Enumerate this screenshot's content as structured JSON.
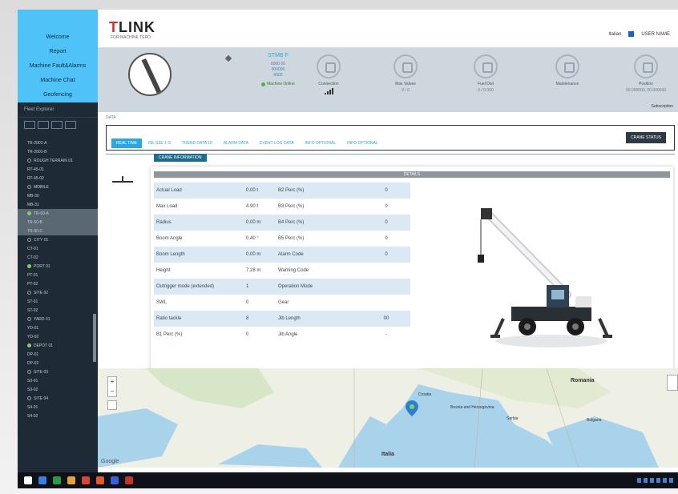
{
  "sidebar": {
    "links": [
      "Welcome",
      "Report",
      "Machine Fault&Alarms",
      "Machine Chat",
      "Geofencing"
    ],
    "tree_header": "Fleet Explorer",
    "items": [
      {
        "label": "TR-2001-A",
        "state": "none"
      },
      {
        "label": "TR-2001-B",
        "state": "none"
      },
      {
        "label": "ROUGH TERRAIN 01",
        "state": "off"
      },
      {
        "label": "RT-45-01",
        "state": "none"
      },
      {
        "label": "RT-45-02",
        "state": "none"
      },
      {
        "label": "MOBILE",
        "state": "off"
      },
      {
        "label": "MB-30",
        "state": "none"
      },
      {
        "label": "MB-31",
        "state": "none"
      },
      {
        "label": "TR-60-A",
        "state": "on",
        "selected": true
      },
      {
        "label": "TR-60-B",
        "state": "none",
        "selected": true
      },
      {
        "label": "TR-60-C",
        "state": "none",
        "selected": true
      },
      {
        "label": "CITY 01",
        "state": "off"
      },
      {
        "label": "CT-01",
        "state": "none"
      },
      {
        "label": "CT-02",
        "state": "none"
      },
      {
        "label": "PORT 01",
        "state": "on"
      },
      {
        "label": "PT-01",
        "state": "none"
      },
      {
        "label": "PT-02",
        "state": "none"
      },
      {
        "label": "SITE 02",
        "state": "off"
      },
      {
        "label": "ST-01",
        "state": "none"
      },
      {
        "label": "ST-02",
        "state": "none"
      },
      {
        "label": "YARD 01",
        "state": "off"
      },
      {
        "label": "YD-01",
        "state": "none"
      },
      {
        "label": "YD-02",
        "state": "none"
      },
      {
        "label": "DEPOT 01",
        "state": "on"
      },
      {
        "label": "DP-01",
        "state": "none"
      },
      {
        "label": "DP-02",
        "state": "none"
      },
      {
        "label": "SITE 03",
        "state": "off"
      },
      {
        "label": "S3-01",
        "state": "none"
      },
      {
        "label": "S3-02",
        "state": "none"
      },
      {
        "label": "SITE 04",
        "state": "off"
      },
      {
        "label": "S4-01",
        "state": "none"
      },
      {
        "label": "S4-02",
        "state": "none"
      }
    ]
  },
  "header": {
    "logo_accent": "T",
    "logo_rest": "LINK",
    "logo_sub": "FOR MACHINE TERO",
    "lang": "Italian",
    "user": "USER NAME"
  },
  "status": {
    "model": "STMB F",
    "model_lines": [
      "0000 00",
      "000000",
      "0000"
    ],
    "online": "Machine Online",
    "kpis": [
      {
        "label": "Connection",
        "value": ""
      },
      {
        "label": "Max Values",
        "value": "0 / 0"
      },
      {
        "label": "Fuel Dist",
        "value": "0 / 0 000"
      },
      {
        "label": "Maintenance",
        "value": ""
      },
      {
        "label": "Position",
        "value": "00.000000, 00.000000"
      }
    ],
    "subscribe": "Subscription"
  },
  "content": {
    "breadcrumb": "DATA",
    "tabs": [
      "REAL TIME",
      "RE-SSE 1-S",
      "TREND DATA 18",
      "ALARM DATA",
      "EVENT LOG DATA",
      "INFO OPTIONAL",
      "INFO OPTIONAL"
    ],
    "crane_status_label": "CRANE STATUS",
    "subtab": "CRANE INFORMATION",
    "details_title": "DETAILS",
    "rows": [
      {
        "k1": "Actual Load",
        "v1": "0.00 t",
        "k2": "B2 Perc (%)",
        "v2": "0"
      },
      {
        "k1": "Max Load",
        "v1": "4.90 t",
        "k2": "B3 Perc (%)",
        "v2": "0"
      },
      {
        "k1": "Radius",
        "v1": "0.00 m",
        "k2": "B4 Perc (%)",
        "v2": "0"
      },
      {
        "k1": "Boom Angle",
        "v1": "0.40 °",
        "k2": "B5 Perc (%)",
        "v2": "0"
      },
      {
        "k1": "Boom Length",
        "v1": "0.00 m",
        "k2": "Alarm Code",
        "v2": "0"
      },
      {
        "k1": "Height",
        "v1": "7.28 m",
        "k2": "Warning Code",
        "v2": ""
      },
      {
        "k1": "Outrigger mode (extended)",
        "v1": "1",
        "k2": "Operation Mode",
        "v2": ""
      },
      {
        "k1": "SWL",
        "v1": "0",
        "k2": "Gear",
        "v2": ""
      },
      {
        "k1": "Ratio tackle",
        "v1": "8",
        "k2": "Jib Length",
        "v2": "00"
      },
      {
        "k1": "B1 Perc (%)",
        "v1": "0",
        "k2": "Jib Angle",
        "v2": "-"
      }
    ]
  },
  "map": {
    "labels": {
      "romania": "Romania",
      "italia": "Italia",
      "croatia": "Croatia",
      "bosnia": "Bosnia and Herzegovina",
      "serbia": "Serbia",
      "bulgaria": "Bulgaria"
    },
    "google": "Google"
  },
  "colors": {
    "accent": "#29a8e0",
    "sidebar": "#1e2a36",
    "sidebar_top": "#4fc3f7",
    "online": "#4caf50"
  }
}
